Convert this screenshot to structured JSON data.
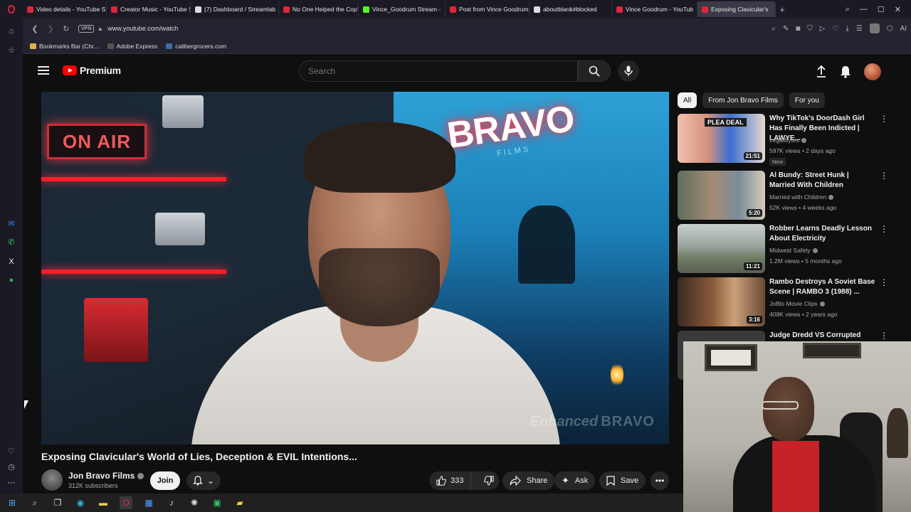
{
  "browser": {
    "tabs": [
      {
        "label": "Video details - YouTube St",
        "color": "#e0253a"
      },
      {
        "label": "Creator Music - YouTube S",
        "color": "#e0253a"
      },
      {
        "label": "(7) Dashboard / Streamlab",
        "color": "#dddddd"
      },
      {
        "label": "No One Helped the Cop?",
        "color": "#e0253a"
      },
      {
        "label": "Vince_Goodrum Stream -",
        "color": "#53fc18"
      },
      {
        "label": "Post from Vince Goodrum",
        "color": "#e0253a"
      },
      {
        "label": "aboutblank#blocked",
        "color": "#dddddd"
      },
      {
        "label": "Vince Goodrum - YouTub",
        "color": "#e0253a"
      },
      {
        "label": "Exposing Clavicular's",
        "color": "#e0253a"
      }
    ],
    "new_tab_label": "+",
    "url": "www.youtube.com/watch",
    "vpn_label": "VPN",
    "ai_label": "AI",
    "bookmarks": [
      {
        "label": "Bookmarks Bar (Chr...",
        "color": "#e0b34a"
      },
      {
        "label": "Adobe Express",
        "color": "#333333"
      },
      {
        "label": "calibergrocers.com",
        "color": "#3a6ea5"
      }
    ]
  },
  "youtube": {
    "logo_text": "Premium",
    "search_placeholder": "Search",
    "video": {
      "title": "Exposing Clavicular's World of Lies, Deception & EVIL Intentions...",
      "sign_text": "BRAVO",
      "sign_sub": "FILMS",
      "on_air_text": "ON AIR",
      "watermark_left": "Enhanced",
      "watermark_right": "BRAVO"
    },
    "channel": {
      "name": "Jon Bravo Films",
      "subscribers": "312K subscribers"
    },
    "actions": {
      "join": "Join",
      "likes": "333",
      "share": "Share",
      "ask": "Ask",
      "save": "Save"
    },
    "chips": [
      "All",
      "From Jon Bravo Films",
      "For you"
    ],
    "recommendations": [
      {
        "title": "Why TikTok's DoorDash Girl Has Finally Been Indicted | LAWYE...",
        "channel": "LegalBytes",
        "meta": "597K views • 2 days ago",
        "badge": "New",
        "duration": "21:51",
        "thumb_overlay": "PLEA DEAL",
        "thumb_color": "#3a6fd0"
      },
      {
        "title": "Al Bundy: Street Hunk | Married With Children",
        "channel": "Married with Children",
        "meta": "52K views • 4 weeks ago",
        "badge": "",
        "duration": "5:20",
        "thumb_overlay": "",
        "thumb_color": "#6c7f6a"
      },
      {
        "title": "Robber Learns Deadly Lesson About Electricity",
        "channel": "Midwest Safety",
        "meta": "1.2M views • 5 months ago",
        "badge": "",
        "duration": "11:21",
        "thumb_overlay": "",
        "thumb_color": "#8a9a88"
      },
      {
        "title": "Rambo Destroys A Soviet Base Scene | RAMBO 3 (1988) ...",
        "channel": "JoBlo Movie Clips",
        "meta": "408K views • 2 years ago",
        "badge": "",
        "duration": "3:16",
        "thumb_overlay": "",
        "thumb_color": "#8a5a3a"
      },
      {
        "title": "Judge Dredd VS Corrupted",
        "channel": "",
        "meta": "",
        "badge": "",
        "duration": "",
        "thumb_overlay": "",
        "thumb_color": "#3a3a3a"
      }
    ]
  },
  "colors": {
    "yt_red": "#ff0000",
    "bg": "#0f0f0f",
    "chip_bg": "#272727"
  }
}
